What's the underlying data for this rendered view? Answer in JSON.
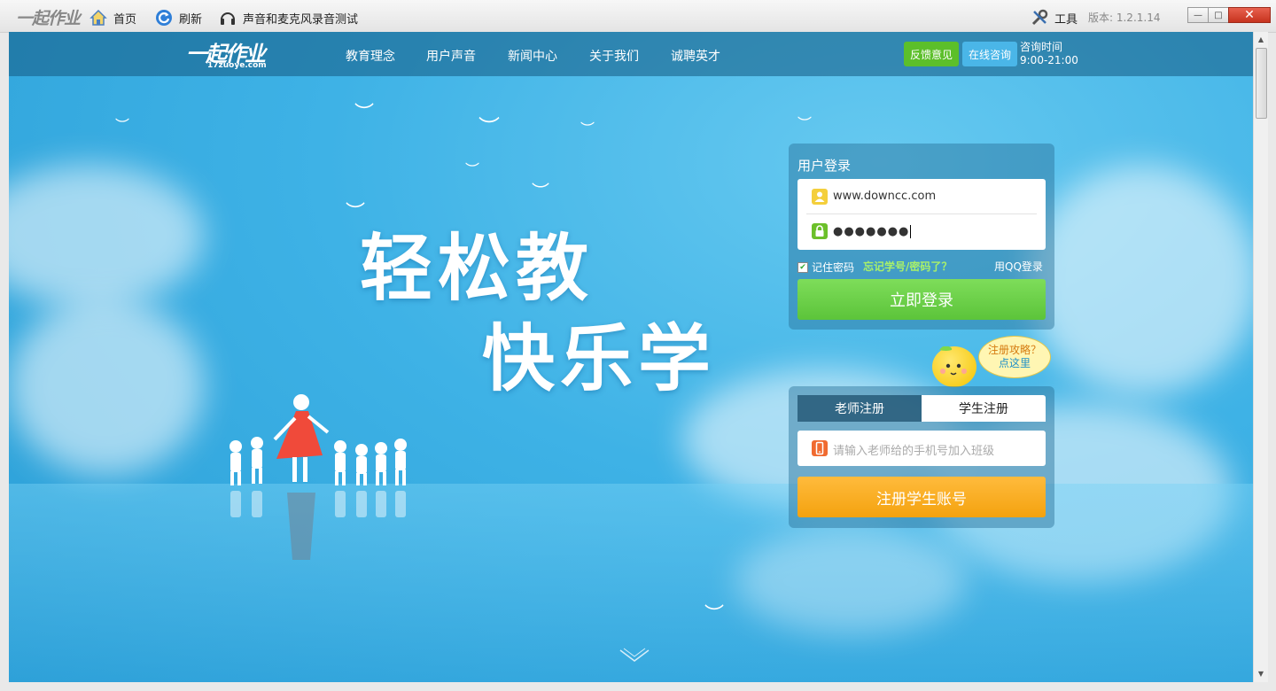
{
  "app": {
    "logo_text": "一起作业",
    "toolbar": {
      "home_label": "首页",
      "refresh_label": "刷新",
      "audio_test_label": "声音和麦克风录音测试",
      "tools_label": "工具",
      "version_text": "版本: 1.2.1.14"
    },
    "window_controls": {
      "minimize": "—",
      "maximize": "□",
      "close": "✕"
    }
  },
  "site": {
    "logo_text": "一起作业",
    "logo_sub": "17zuoye.com",
    "nav": [
      "教育理念",
      "用户声音",
      "新闻中心",
      "关于我们",
      "诚聘英才"
    ],
    "feedback_label": "反馈意见",
    "online_consult_label": "在线咨询",
    "consult_time_title": "咨询时间",
    "consult_time_hours": "9:00-21:00",
    "slogan_line1": "轻松教",
    "slogan_line2": "快乐学"
  },
  "login": {
    "title": "用户登录",
    "username_value": "www.downcc.com",
    "password_value": "●●●●●●●",
    "remember_label": "记住密码",
    "remember_checked": true,
    "forgot_label": "忘记学号/密码了？",
    "qq_login_label": "用QQ登录",
    "submit_label": "立即登录"
  },
  "register": {
    "bubble_line1": "注册攻略？",
    "bubble_line2": "点这里",
    "tab_teacher": "老师注册",
    "tab_student": "学生注册",
    "active_tab": "学生注册",
    "phone_placeholder": "请输入老师给的手机号加入班级",
    "submit_label": "注册学生账号"
  },
  "colors": {
    "login_button": "#5cc43a",
    "register_button": "#f4a20f",
    "feedback_button": "#5cbf2a",
    "online_button": "#4ab6e8",
    "sky": "#3eb2e6"
  },
  "icons": {
    "home": "house-icon",
    "refresh": "refresh-icon",
    "audio": "headphone-icon",
    "tools": "wrench-icon",
    "user": "user-icon",
    "lock": "lock-icon",
    "phone": "phone-icon",
    "scroll": "chevron-down-icon"
  }
}
